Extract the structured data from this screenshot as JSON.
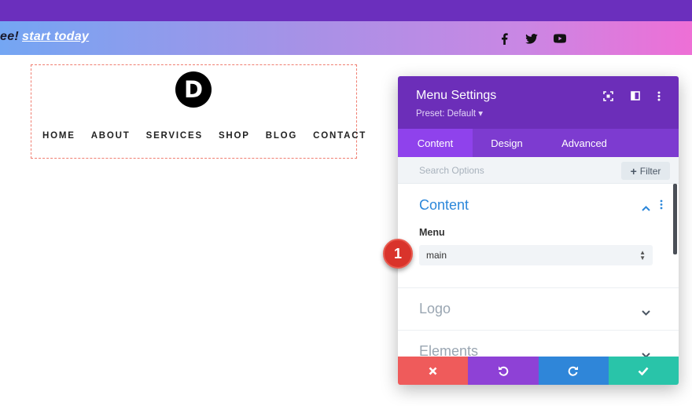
{
  "promo": {
    "text": "ee!",
    "cta": "start today"
  },
  "social": {
    "facebook": "facebook-icon",
    "twitter": "twitter-icon",
    "youtube": "youtube-icon"
  },
  "site": {
    "logo_letter": "D",
    "nav": [
      "HOME",
      "ABOUT",
      "SERVICES",
      "SHOP",
      "BLOG",
      "CONTACT"
    ]
  },
  "panel": {
    "title": "Menu Settings",
    "preset": "Preset: Default ▾",
    "tabs": [
      {
        "label": "Content",
        "active": true
      },
      {
        "label": "Design",
        "active": false
      },
      {
        "label": "Advanced",
        "active": false
      }
    ],
    "search_placeholder": "Search Options",
    "filter_label": "Filter",
    "sections": [
      {
        "title": "Content",
        "open": true
      },
      {
        "title": "Logo",
        "open": false
      },
      {
        "title": "Elements",
        "open": false
      }
    ],
    "menu_field_label": "Menu",
    "menu_field_value": "main",
    "footer": [
      "cancel",
      "undo",
      "redo",
      "save"
    ]
  },
  "badge": {
    "number": "1"
  },
  "colors": {
    "purple_header": "#6c2eb9",
    "tab_bar": "#7d3bd0",
    "tab_active": "#8f42ec",
    "accent_blue": "#2b87da",
    "cancel": "#ef5b5b",
    "undo": "#8e41d6",
    "redo": "#2f86d9",
    "save": "#29c4a9",
    "badge": "#d9332b"
  }
}
